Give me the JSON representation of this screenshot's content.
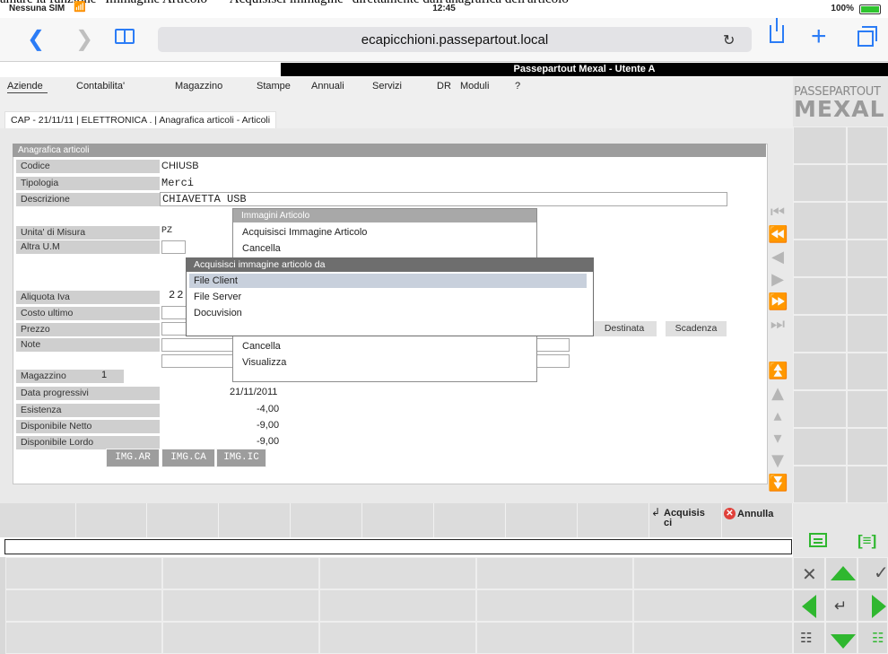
{
  "caption_cutoff": "amare la funzione \"Immagine Articolo\" - \"Acquisisci immagine\" direttamente dall'anagrafica dell'articolo",
  "statusbar": {
    "carrier": "Nessuna SIM",
    "time": "12:45",
    "battery": "100%"
  },
  "browser": {
    "url": "ecapicchioni.passepartout.local"
  },
  "app": {
    "title": "Passepartout Mexal - Utente A",
    "logo_line1": "PASSEPARTOUT",
    "logo_line2": "MEXAL"
  },
  "menu": [
    "Aziende",
    "Contabilita'",
    "Magazzino",
    "Stampe",
    "Annuali",
    "Servizi",
    "DR",
    "Moduli",
    "?"
  ],
  "breadcrumb": "CAP - 21/11/11 | ELETTRONICA . | Anagrafica articoli - Articoli",
  "form": {
    "title": "Anagrafica articoli",
    "codice_label": "Codice",
    "codice": "CHIUSB",
    "tipologia_label": "Tipologia",
    "tipologia": "Merci",
    "descrizione_label": "Descrizione",
    "descrizione": "CHIAVETTA USB",
    "unita_label": "Unita' di Misura",
    "unita": "PZ",
    "altra_um_label": "Altra U.M",
    "aliquota_label": "Aliquota Iva",
    "aliquota": "22",
    "costo_label": "Costo ultimo",
    "prezzo_label": "Prezzo",
    "note_label": "Note",
    "destinata_label": "Destinata",
    "scadenza_label": "Scadenza",
    "magazzino_label": "Magazzino",
    "magazzino": "1",
    "data_prog_label": "Data progressivi",
    "data_prog": "21/11/2011",
    "esistenza_label": "Esistenza",
    "esistenza": "-4,00",
    "disp_netto_label": "Disponibile Netto",
    "disp_netto": "-9,00",
    "disp_lordo_label": "Disponibile Lordo",
    "disp_lordo": "-9,00",
    "img_buttons": [
      "IMG.AR",
      "IMG.CA",
      "IMG.IC"
    ]
  },
  "popup_immagini": {
    "title": "Immagini Articolo",
    "items": [
      "Acquisisci Immagine Articolo",
      "Cancella",
      "Cancella",
      "Visualizza"
    ]
  },
  "popup_acquisisci": {
    "title": "Acquisisci immagine articolo da",
    "items": [
      "File Client",
      "File Server",
      "Docuvision"
    ],
    "selected": "File Client"
  },
  "actions": {
    "acquisisci": "Acquisisci",
    "annulla": "Annulla"
  },
  "colors": {
    "accent_blue": "#2b7cf6",
    "keypad_green": "#2fb72f",
    "cancel_red": "#e0403a"
  }
}
